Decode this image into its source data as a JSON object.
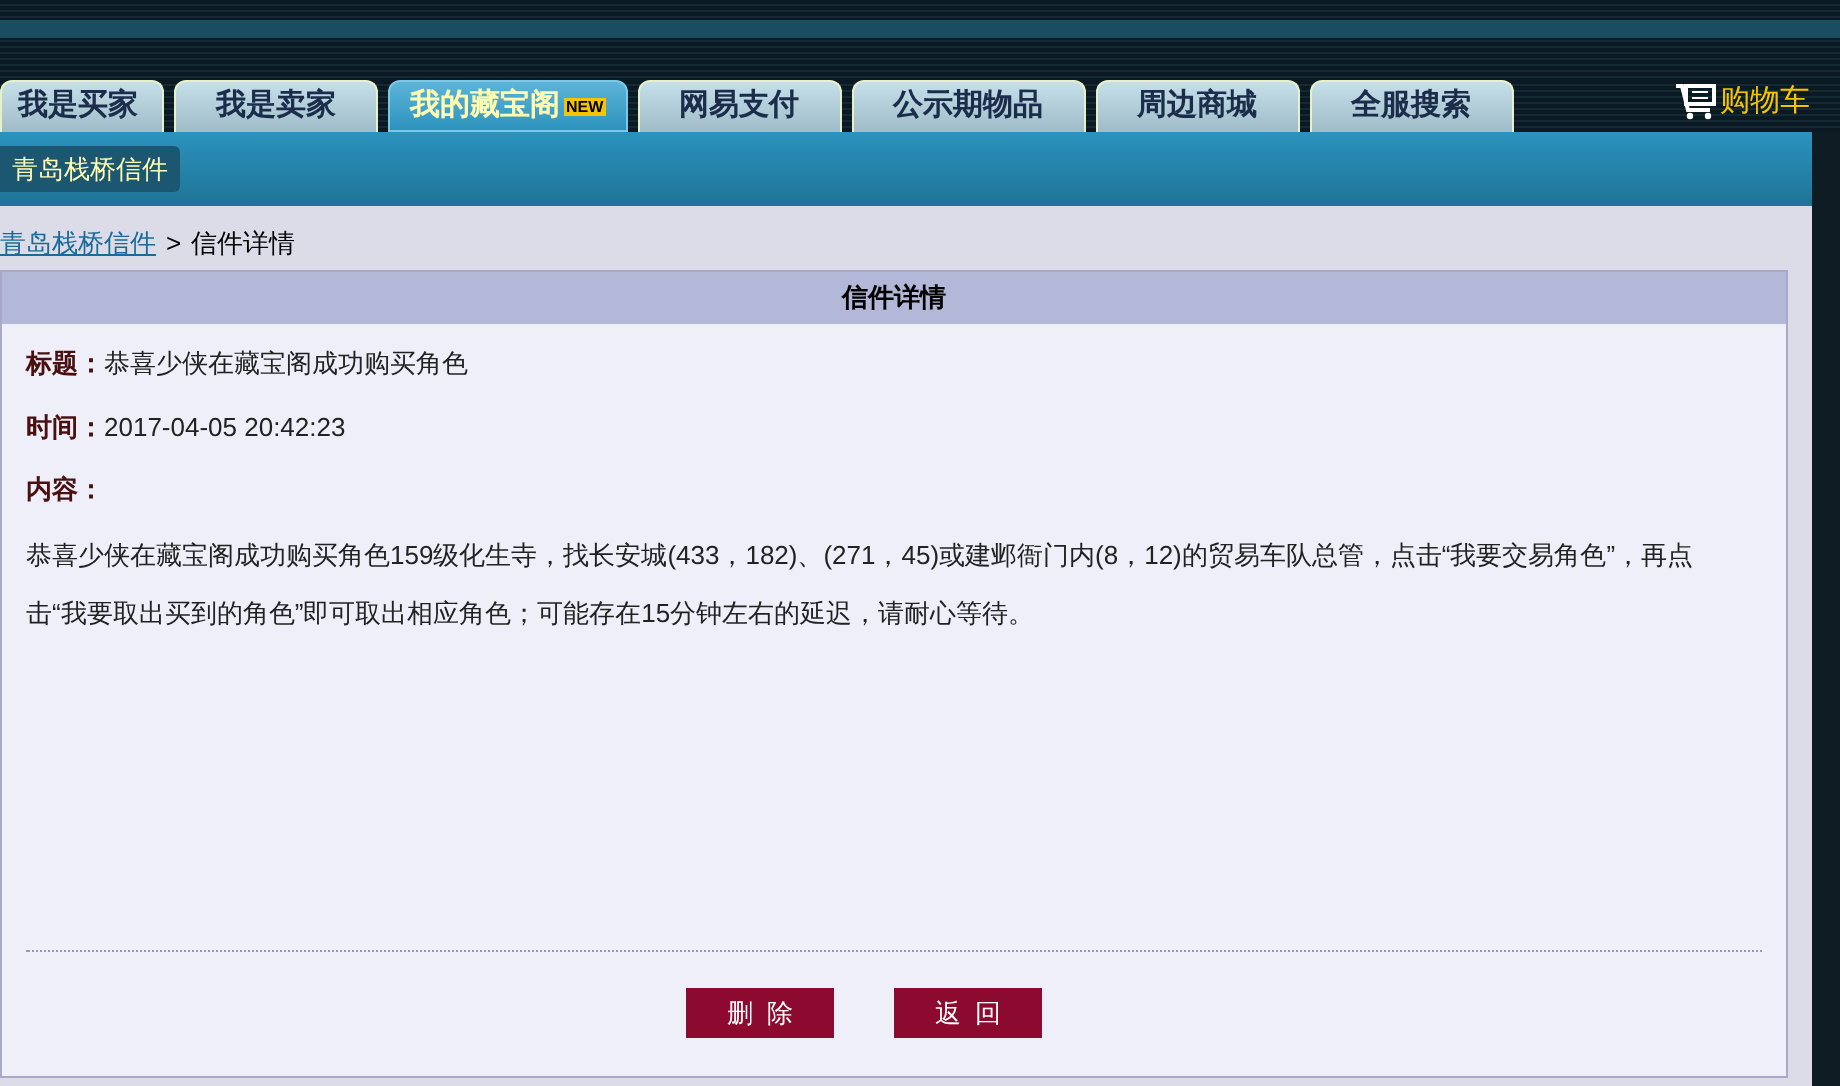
{
  "tabs": [
    {
      "label": "我是买家",
      "selected": false
    },
    {
      "label": "我是卖家",
      "selected": false
    },
    {
      "label": "我的藏宝阁",
      "selected": true,
      "badge": "NEW"
    },
    {
      "label": "网易支付",
      "selected": false
    },
    {
      "label": "公示期物品",
      "selected": false
    },
    {
      "label": "周边商城",
      "selected": false
    },
    {
      "label": "全服搜索",
      "selected": false
    }
  ],
  "cart": {
    "label": "购物车"
  },
  "subnav": {
    "label": "青岛栈桥信件"
  },
  "breadcrumb": {
    "link": "青岛栈桥信件",
    "separator": ">",
    "current": "信件详情"
  },
  "panel": {
    "title": "信件详情",
    "fields": [
      {
        "label": "标题：",
        "value": "恭喜少侠在藏宝阁成功购买角色"
      },
      {
        "label": "时间：",
        "value": "2017-04-05 20:42:23"
      },
      {
        "label": "内容："
      }
    ],
    "content": "恭喜少侠在藏宝阁成功购买角色159级化生寺，找长安城(433，182)、(271，45)或建邺衙门内(8，12)的贸易车队总管，点击“我要交易角色”，再点击“我要取出买到的角色”即可取出相应角色；可能存在15分钟左右的延迟，请耐心等待。",
    "buttons": [
      "删  除",
      "返  回"
    ]
  }
}
